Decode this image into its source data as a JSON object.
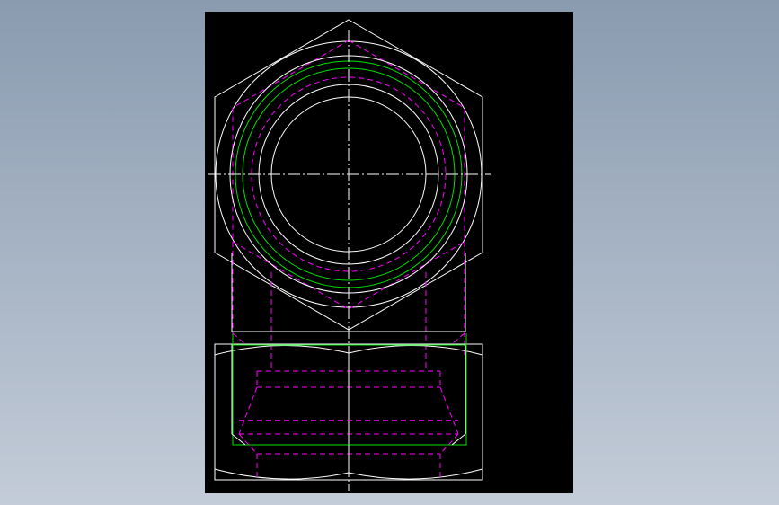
{
  "colors": {
    "background_top": "#8a9bb0",
    "background_bottom": "#c3ccd8",
    "viewport": "#000000",
    "outline": "#ffffff",
    "thread_major": "#00e000",
    "hidden": "#ff00ff",
    "centerline": "#ffffff"
  },
  "drawing": {
    "subject": "hex-nut",
    "views": [
      "top-view",
      "front-view"
    ]
  }
}
